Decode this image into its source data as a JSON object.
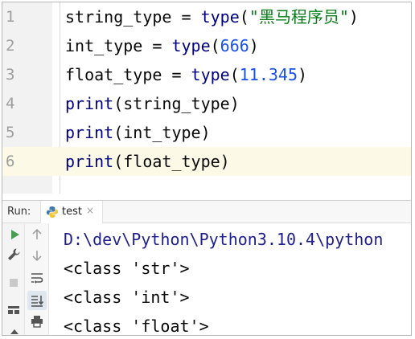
{
  "editor": {
    "lines": [
      {
        "num": "1",
        "parts": [
          "string_type = ",
          "type",
          "(",
          "\"黑马程序员\"",
          ")"
        ]
      },
      {
        "num": "2",
        "parts": [
          "int_type = ",
          "type",
          "(",
          "666",
          ")"
        ]
      },
      {
        "num": "3",
        "parts": [
          "float_type = ",
          "type",
          "(",
          "11.345",
          ")"
        ]
      },
      {
        "num": "4",
        "parts": [
          "print",
          "(string_type)"
        ]
      },
      {
        "num": "5",
        "parts": [
          "print",
          "(int_type)"
        ]
      },
      {
        "num": "6",
        "parts": [
          "print",
          "(float_type)"
        ]
      }
    ]
  },
  "run_panel": {
    "label": "Run:",
    "tab_name": "test",
    "tab_close": "×",
    "output": [
      "D:\\dev\\Python\\Python3.10.4\\python",
      "<class 'str'>",
      "<class 'int'>",
      "<class 'float'>"
    ]
  },
  "icons": {
    "run": "run-icon",
    "wrench": "wrench-icon",
    "stop": "stop-icon",
    "layout": "layout-icon",
    "up": "up-arrow-icon",
    "down": "down-arrow-icon",
    "soft_wrap": "soft-wrap-icon",
    "scroll_end": "scroll-to-end-icon",
    "print": "print-icon",
    "python": "python-icon"
  },
  "colors": {
    "gutter": "#f2f2f2",
    "keyword_builtin": "#000080",
    "number": "#1750eb",
    "string": "#067d17",
    "run_green": "#499c54"
  }
}
